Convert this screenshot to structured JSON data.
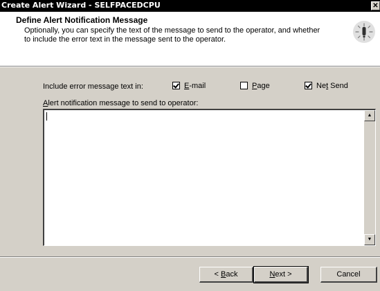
{
  "window": {
    "title": "Create Alert Wizard - SELFPACEDCPU",
    "close_glyph": "✕"
  },
  "header": {
    "title": "Define Alert Notification Message",
    "description": "Optionally, you can specify the text of the message to send to the operator, and whether to include the error text in the message sent to the operator.",
    "icon": "alert-wizard-icon"
  },
  "options": {
    "include_label": "Include error message text in:",
    "email": {
      "pre": "",
      "ul": "E",
      "post": "-mail",
      "checked": true
    },
    "page": {
      "pre": "",
      "ul": "P",
      "post": "age",
      "checked": false
    },
    "netsend": {
      "pre": "Ne",
      "ul": "t",
      "post": " Send",
      "checked": true
    }
  },
  "message": {
    "label_ul": "A",
    "label_rest": "lert notification message to send to operator:",
    "value": ""
  },
  "buttons": {
    "back": {
      "pre": "< ",
      "ul": "B",
      "post": "ack"
    },
    "next": {
      "pre": "",
      "ul": "N",
      "post": "ext >"
    },
    "cancel": "Cancel"
  }
}
